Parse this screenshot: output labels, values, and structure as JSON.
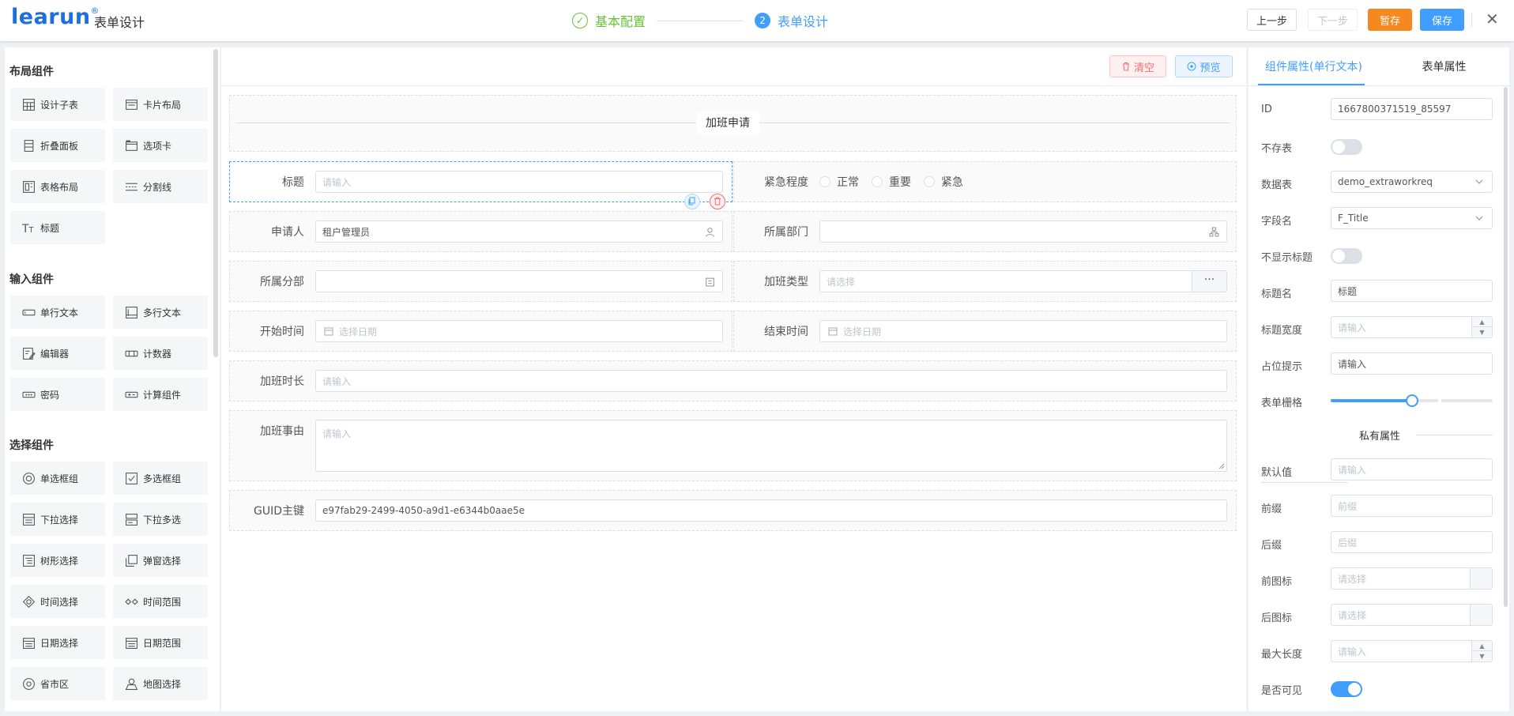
{
  "header": {
    "logo": "learun",
    "logo_mark": "®",
    "title": "表单设计",
    "steps": [
      {
        "num": "✓",
        "label": "基本配置"
      },
      {
        "num": "2",
        "label": "表单设计"
      }
    ],
    "btn_prev": "上一步",
    "btn_next": "下一步",
    "btn_draft": "暂存",
    "btn_save": "保存",
    "close": "✕"
  },
  "left": {
    "groups": [
      {
        "title": "布局组件",
        "items": [
          {
            "label": "设计子表",
            "icon": "subtable-icon"
          },
          {
            "label": "卡片布局",
            "icon": "card-icon"
          },
          {
            "label": "折叠面板",
            "icon": "collapse-icon"
          },
          {
            "label": "选项卡",
            "icon": "tabs-icon"
          },
          {
            "label": "表格布局",
            "icon": "table-layout-icon"
          },
          {
            "label": "分割线",
            "icon": "divider-icon"
          },
          {
            "label": "标题",
            "icon": "title-icon"
          }
        ]
      },
      {
        "title": "输入组件",
        "items": [
          {
            "label": "单行文本",
            "icon": "input-icon"
          },
          {
            "label": "多行文本",
            "icon": "textarea-icon"
          },
          {
            "label": "编辑器",
            "icon": "editor-icon"
          },
          {
            "label": "计数器",
            "icon": "counter-icon"
          },
          {
            "label": "密码",
            "icon": "password-icon"
          },
          {
            "label": "计算组件",
            "icon": "calc-icon"
          }
        ]
      },
      {
        "title": "选择组件",
        "items": [
          {
            "label": "单选框组",
            "icon": "radio-icon"
          },
          {
            "label": "多选框组",
            "icon": "checkbox-icon"
          },
          {
            "label": "下拉选择",
            "icon": "select-icon"
          },
          {
            "label": "下拉多选",
            "icon": "multiselect-icon"
          },
          {
            "label": "树形选择",
            "icon": "tree-icon"
          },
          {
            "label": "弹窗选择",
            "icon": "popup-icon"
          },
          {
            "label": "时间选择",
            "icon": "time-icon"
          },
          {
            "label": "时间范围",
            "icon": "time-range-icon"
          },
          {
            "label": "日期选择",
            "icon": "date-icon"
          },
          {
            "label": "日期范围",
            "icon": "date-range-icon"
          },
          {
            "label": "省市区",
            "icon": "location-icon"
          },
          {
            "label": "地图选择",
            "icon": "map-icon"
          }
        ]
      }
    ]
  },
  "canvas": {
    "btn_clear": "清空",
    "btn_preview": "预览",
    "section_title": "加班申请",
    "fields": {
      "title_label": "标题",
      "title_ph": "请输入",
      "urgency_label": "紧急程度",
      "urgency_options": [
        "正常",
        "重要",
        "紧急"
      ],
      "applicant_label": "申请人",
      "applicant_value": "租户管理员",
      "dept_label": "所属部门",
      "branch_label": "所属分部",
      "ot_type_label": "加班类型",
      "ot_type_ph": "请选择",
      "ot_type_more": "···",
      "start_label": "开始时间",
      "start_ph": "选择日期",
      "end_label": "结束时间",
      "end_ph": "选择日期",
      "duration_label": "加班时长",
      "duration_ph": "请输入",
      "reason_label": "加班事由",
      "reason_ph": "请输入",
      "guid_label": "GUID主键",
      "guid_value": "e97fab29-2499-4050-a9d1-e6344b0aae5e"
    }
  },
  "right": {
    "tab_component": "组件属性(单行文本)",
    "tab_form": "表单属性",
    "props": {
      "id_label": "ID",
      "id_value": "1667800371519_85597",
      "nostore_label": "不存表",
      "table_label": "数据表",
      "table_value": "demo_extraworkreq",
      "field_label": "字段名",
      "field_value": "F_Title",
      "hide_title_label": "不显示标题",
      "title_name_label": "标题名",
      "title_name_value": "标题",
      "title_width_label": "标题宽度",
      "title_width_ph": "请输入",
      "placeholder_label": "占位提示",
      "placeholder_value": "请输入",
      "grid_label": "表单栅格",
      "grid_span_fraction": 0.5,
      "private_title": "私有属性",
      "default_label": "默认值",
      "default_ph": "请输入",
      "prefix_label": "前缀",
      "prefix_ph": "前缀",
      "suffix_label": "后缀",
      "suffix_ph": "后缀",
      "prefix_icon_label": "前图标",
      "prefix_icon_ph": "请选择",
      "suffix_icon_label": "后图标",
      "suffix_icon_ph": "请选择",
      "maxlen_label": "最大长度",
      "maxlen_ph": "请输入",
      "visible_label": "是否可见"
    }
  },
  "colors": {
    "primary": "#409eff",
    "success": "#67c23a",
    "danger": "#f56c6c",
    "warning": "#f5891f",
    "logo": "#1d6fe0"
  }
}
